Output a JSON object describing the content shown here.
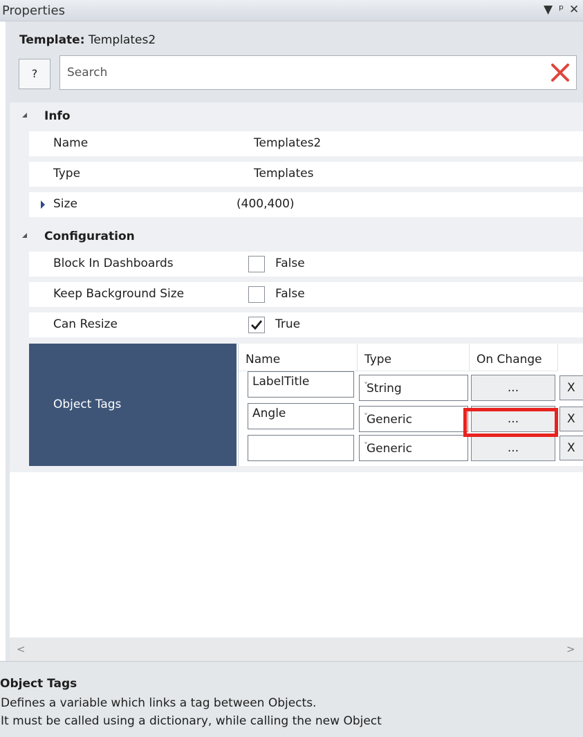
{
  "panel": {
    "title": "Properties"
  },
  "template": {
    "label": "Template:",
    "name": "Templates2"
  },
  "toolbar": {
    "help_label": "?",
    "search_placeholder": "Search"
  },
  "categories": [
    {
      "label": "Info",
      "expanded": true
    },
    {
      "label": "Configuration",
      "expanded": true
    }
  ],
  "info": {
    "name": {
      "label": "Name",
      "value": "Templates2"
    },
    "type": {
      "label": "Type",
      "value": "Templates"
    },
    "size": {
      "label": "Size",
      "value": "(400,400)"
    }
  },
  "config": {
    "block_in_dashboards": {
      "label": "Block In Dashboards",
      "checked": false,
      "value": "False"
    },
    "keep_background_size": {
      "label": "Keep Background Size",
      "checked": false,
      "value": "False"
    },
    "can_resize": {
      "label": "Can Resize",
      "checked": true,
      "value": "True"
    }
  },
  "object_tags": {
    "label": "Object Tags",
    "columns": [
      "Name",
      "Type",
      "On Change"
    ],
    "rows": [
      {
        "name": "LabelTitle",
        "type": "String",
        "on_change": "...",
        "remove": "X"
      },
      {
        "name": "Angle",
        "type": "Generic",
        "on_change": "...",
        "remove": "X"
      },
      {
        "name": "",
        "type": "Generic",
        "on_change": "...",
        "remove": "X"
      }
    ]
  },
  "description": {
    "title": "Object Tags",
    "line1": "Defines a variable which links a tag between Objects.",
    "line2": "It must be called using a dictionary, while calling the new Object"
  },
  "colors": {
    "tags_header": "#3e5578",
    "highlight": "#e8231f",
    "clear_icon": "#e0453b"
  }
}
